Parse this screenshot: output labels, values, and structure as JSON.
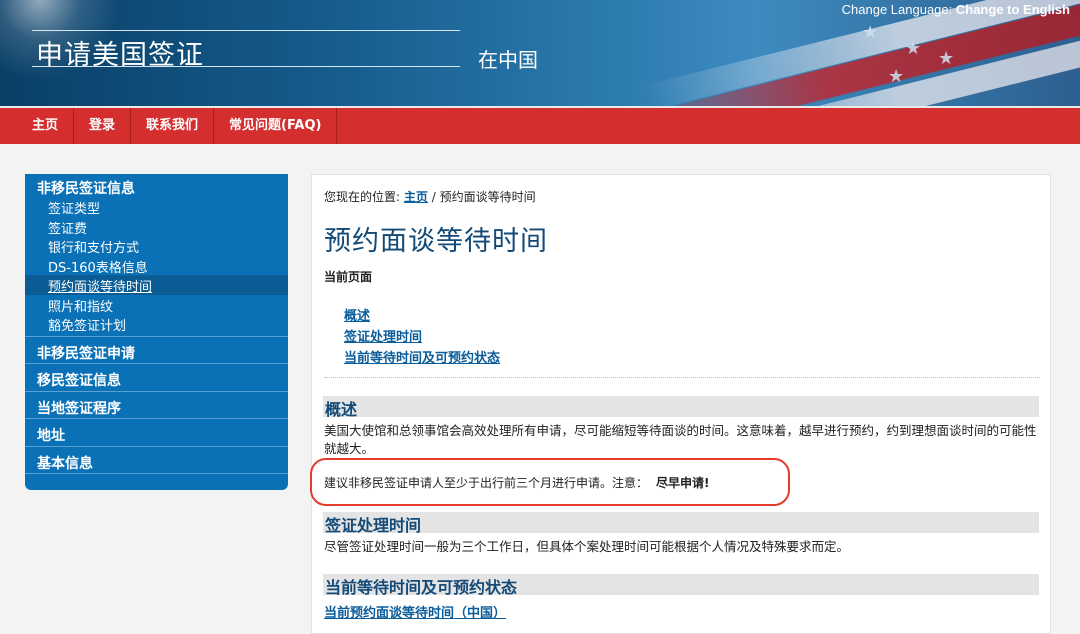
{
  "header": {
    "site_title": "申请美国签证",
    "site_subtitle": "在中国",
    "language_label": "Change Language:",
    "language_link": "Change to English"
  },
  "nav": {
    "items": [
      {
        "label": "主页"
      },
      {
        "label": "登录"
      },
      {
        "label": "联系我们"
      },
      {
        "label": "常见问题(FAQ)"
      }
    ]
  },
  "sidebar": {
    "group1": {
      "label": "非移民签证信息",
      "items": [
        {
          "label": "签证类型"
        },
        {
          "label": "签证费"
        },
        {
          "label": "银行和支付方式"
        },
        {
          "label": "DS-160表格信息"
        },
        {
          "label": "预约面谈等待时间"
        },
        {
          "label": "照片和指纹"
        },
        {
          "label": "豁免签证计划"
        }
      ]
    },
    "groups": [
      {
        "label": "非移民签证申请"
      },
      {
        "label": "移民签证信息"
      },
      {
        "label": "当地签证程序"
      },
      {
        "label": "地址"
      },
      {
        "label": "基本信息"
      }
    ]
  },
  "main": {
    "breadcrumb_prefix": "您现在的位置:",
    "breadcrumb_home": "主页",
    "breadcrumb_sep": " / ",
    "breadcrumb_current": "预约面谈等待时间",
    "title": "预约面谈等待时间",
    "current_page_label": "当前页面",
    "toc": [
      {
        "label": "概述"
      },
      {
        "label": "签证处理时间"
      },
      {
        "label": "当前等待时间及可预约状态"
      }
    ],
    "section1": {
      "heading": "概述",
      "text": "美国大使馆和总领事馆会高效处理所有申请，尽可能缩短等待面谈的时间。这意味着，越早进行预约，约到理想面谈时间的可能性就越大。",
      "note": "建议非移民签证申请人至少于出行前三个月进行申请。注意：",
      "note_bold": "尽早申请!"
    },
    "section2": {
      "heading": "签证处理时间",
      "text": "尽管签证处理时间一般为三个工作日，但具体个案处理时间可能根据个人情况及特殊要求而定。"
    },
    "section3": {
      "heading": "当前等待时间及可预约状态",
      "link": "当前预约面谈等待时间（中国）"
    }
  },
  "colors": {
    "nav_red": "#d42e2f",
    "sidebar_blue": "#0a71b7",
    "title_blue": "#134a77",
    "highlight_red": "#e43b2f"
  }
}
